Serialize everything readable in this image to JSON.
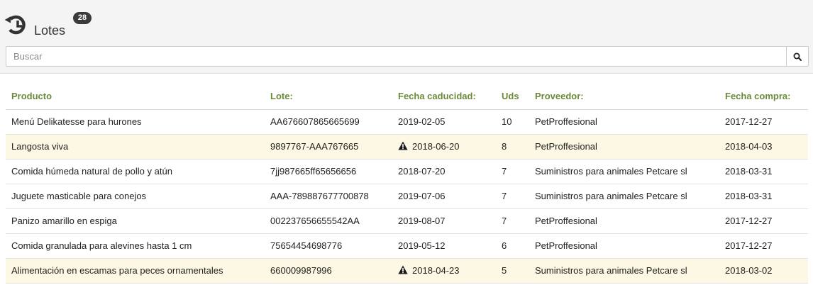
{
  "header": {
    "title": "Lotes",
    "badge_count": "28"
  },
  "search": {
    "placeholder": "Buscar",
    "value": ""
  },
  "table": {
    "columns": [
      "Producto",
      "Lote:",
      "Fecha caducidad:",
      "Uds",
      "Proveedor:",
      "Fecha compra:"
    ],
    "rows": [
      {
        "producto": "Menú Delikatesse para hurones",
        "lote": "AA676607865665699",
        "caducidad": "2019-02-05",
        "uds": "10",
        "proveedor": "PetProffesional",
        "compra": "2017-12-27",
        "warning": false
      },
      {
        "producto": "Langosta viva",
        "lote": "9897767-AAA767665",
        "caducidad": "2018-06-20",
        "uds": "8",
        "proveedor": "PetProffesional",
        "compra": "2018-04-03",
        "warning": true
      },
      {
        "producto": "Comida húmeda natural de pollo y atún",
        "lote": "7jj987665ff65656656",
        "caducidad": "2018-07-20",
        "uds": "7",
        "proveedor": "Suministros para animales Petcare sl",
        "compra": "2018-03-31",
        "warning": false
      },
      {
        "producto": "Juguete masticable para conejos",
        "lote": "AAA-789887677700878",
        "caducidad": "2019-07-06",
        "uds": "7",
        "proveedor": "Suministros para animales Petcare sl",
        "compra": "2018-03-31",
        "warning": false
      },
      {
        "producto": "Panizo amarillo en espiga",
        "lote": "002237656655542AA",
        "caducidad": "2019-08-07",
        "uds": "7",
        "proveedor": "PetProffesional",
        "compra": "2017-12-27",
        "warning": false
      },
      {
        "producto": "Comida granulada para alevines hasta 1 cm",
        "lote": "75654454698776",
        "caducidad": "2019-05-12",
        "uds": "6",
        "proveedor": "PetProffesional",
        "compra": "2017-12-27",
        "warning": false
      },
      {
        "producto": "Alimentación en escamas para peces ornamentales",
        "lote": "660009987996",
        "caducidad": "2018-04-23",
        "uds": "5",
        "proveedor": "Suministros para animales Petcare sl",
        "compra": "2018-03-02",
        "warning": true
      }
    ]
  },
  "icons": {
    "header": "history-icon",
    "search": "search-icon",
    "expiry_warning": "warning-icon"
  },
  "colors": {
    "header_text": "#6b8a3a",
    "warning_row": "#fcf8e3",
    "badge": "#3a3a3a"
  }
}
